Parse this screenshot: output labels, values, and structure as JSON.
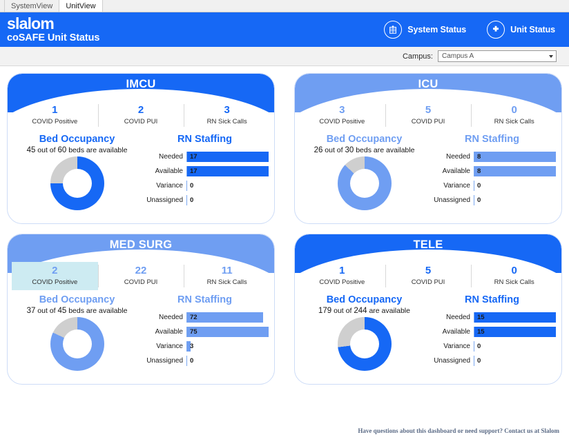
{
  "tabs": [
    {
      "label": "SystemView",
      "active": false
    },
    {
      "label": "UnitView",
      "active": true
    }
  ],
  "header": {
    "logo": "slalom",
    "subtitle": "coSAFE Unit Status",
    "nav": [
      {
        "label": "System Status",
        "icon": "hospital-building-icon"
      },
      {
        "label": "Unit Status",
        "icon": "medical-cross-icon"
      }
    ]
  },
  "campus": {
    "label": "Campus:",
    "value": "Campus A",
    "placeholder": "Campus A",
    "options": [
      "Campus A"
    ]
  },
  "colors": {
    "brand_blue": "#1668f5",
    "light_blue": "#6f9ef2",
    "donut_empty": "#cfcfcf",
    "highlight": "#cdebf2"
  },
  "panel_labels": {
    "bed_occupancy": "Bed Occupancy",
    "rn_staffing": "RN Staffing",
    "kpi_covid_positive": "COVID Positive",
    "kpi_covid_pui": "COVID PUI",
    "kpi_rn_sick_calls": "RN Sick Calls",
    "bar_needed": "Needed",
    "bar_available": "Available",
    "bar_variance": "Variance",
    "bar_unassigned": "Unassigned"
  },
  "units": [
    {
      "name": "IMCU",
      "theme": "dark",
      "kpis": {
        "covid_positive": "1",
        "covid_pui": "2",
        "rn_sick_calls": "3",
        "highlight": "none"
      },
      "beds": {
        "text_available": "45",
        "text_middle": "out of",
        "text_total": "60",
        "text_suffix": "beds are available",
        "available": 45,
        "total": 60,
        "percent": 75
      },
      "staffing": {
        "needed": "17",
        "available": "17",
        "variance": "0",
        "unassigned": "0",
        "needed_pct": 100,
        "available_pct": 100,
        "variance_pct": 0,
        "unassigned_pct": 0
      }
    },
    {
      "name": "ICU",
      "theme": "light",
      "kpis": {
        "covid_positive": "3",
        "covid_pui": "5",
        "rn_sick_calls": "0",
        "highlight": "none"
      },
      "beds": {
        "text_available": "26",
        "text_middle": "out of",
        "text_total": "30",
        "text_suffix": "beds are available",
        "available": 26,
        "total": 30,
        "percent": 87
      },
      "staffing": {
        "needed": "8",
        "available": "8",
        "variance": "0",
        "unassigned": "0",
        "needed_pct": 100,
        "available_pct": 100,
        "variance_pct": 0,
        "unassigned_pct": 0
      }
    },
    {
      "name": "MED SURG",
      "theme": "light",
      "kpis": {
        "covid_positive": "2",
        "covid_pui": "22",
        "rn_sick_calls": "11",
        "highlight": "covid_positive"
      },
      "beds": {
        "text_available": "37",
        "text_middle": "out of",
        "text_total": "45",
        "text_suffix": "beds are available",
        "available": 37,
        "total": 45,
        "percent": 82
      },
      "staffing": {
        "needed": "72",
        "available": "75",
        "variance": "3",
        "unassigned": "0",
        "needed_pct": 93,
        "available_pct": 100,
        "variance_pct": 4,
        "unassigned_pct": 0
      }
    },
    {
      "name": "TELE",
      "theme": "dark",
      "kpis": {
        "covid_positive": "1",
        "covid_pui": "5",
        "rn_sick_calls": "0",
        "highlight": "none"
      },
      "beds": {
        "text_available": "179",
        "text_middle": "out of",
        "text_total": "244",
        "text_suffix": "are available",
        "available": 179,
        "total": 244,
        "percent": 73
      },
      "staffing": {
        "needed": "15",
        "available": "15",
        "variance": "0",
        "unassigned": "0",
        "needed_pct": 100,
        "available_pct": 100,
        "variance_pct": 0,
        "unassigned_pct": 0
      }
    }
  ],
  "footer": {
    "text": "Have questions about this dashboard or need support? Contact us at Slalom"
  }
}
